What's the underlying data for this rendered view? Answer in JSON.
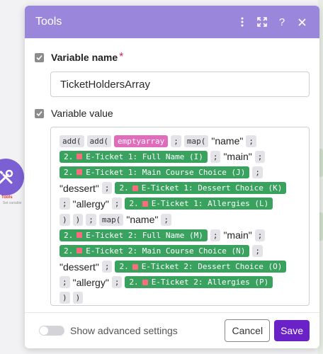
{
  "background": {
    "node_label": "Tools",
    "node_sublabel": "Set variable"
  },
  "dialog": {
    "title": "Tools",
    "header_icons": [
      "more-vertical-icon",
      "expand-icon",
      "help-icon",
      "close-icon"
    ]
  },
  "fields": {
    "variable_name": {
      "label": "Variable name",
      "required_mark": "*",
      "value": "TicketHoldersArray"
    },
    "variable_value": {
      "label": "Variable value",
      "tokens": {
        "add1": "add(",
        "add2": "add(",
        "emptyarray": "emptyarray",
        "semi": ";",
        "map1": "map(",
        "name": "\"name\"",
        "main": "\"main\"",
        "dessert": "\"dessert\"",
        "allergy": "\"allergy\"",
        "close": ")",
        "map2": "map(",
        "t1_fullname": "E-Ticket 1: Full Name (I)",
        "t1_main": "E-Ticket 1: Main Course Choice (J)",
        "t1_dessert": "E-Ticket 1: Dessert Choice (K)",
        "t1_allergy": "E-Ticket 1: Allergies (L)",
        "t2_fullname": "E-Ticket 2: Full Name (M)",
        "t2_main": "E-Ticket 2: Main Course Choice (N)",
        "t2_dessert": "E-Ticket 2: Dessert Choice (O)",
        "t2_allergy": "E-Ticket 2: Allergies (P)",
        "module_num": "2."
      }
    }
  },
  "footer": {
    "advanced_label": "Show advanced settings",
    "advanced_on": false,
    "cancel_label": "Cancel",
    "save_label": "Save"
  },
  "colors": {
    "header": "#9a87dc",
    "save": "#6b21c8",
    "pill_green": "#3aa25f",
    "pill_pink": "#e06cbb"
  }
}
